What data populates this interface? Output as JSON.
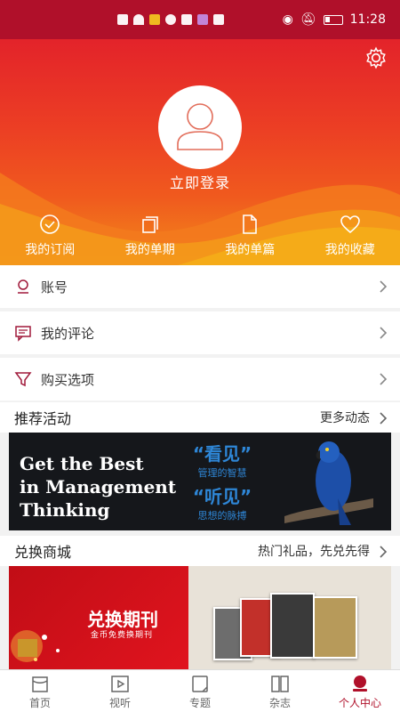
{
  "statusbar": {
    "time": "11:28"
  },
  "header": {
    "login_label": "立即登录",
    "quick_links": [
      {
        "label": "我的订阅",
        "icon": "check-circle-icon"
      },
      {
        "label": "我的单期",
        "icon": "copy-icon"
      },
      {
        "label": "我的单篇",
        "icon": "document-icon"
      },
      {
        "label": "我的收藏",
        "icon": "heart-icon"
      }
    ]
  },
  "menu": [
    {
      "label": "账号",
      "icon": "account-icon"
    },
    {
      "label": "我的评论",
      "icon": "comment-icon"
    },
    {
      "label": "购买选项",
      "icon": "filter-icon"
    }
  ],
  "recommend": {
    "title": "推荐活动",
    "more": "更多动态",
    "banner": {
      "en_lines": [
        "Get the Best",
        "in Management",
        "Thinking"
      ],
      "cn_big_1": "“看见”",
      "cn_small_1": "管理的智慧",
      "cn_big_2": "“听见”",
      "cn_small_2": "思想的脉搏"
    }
  },
  "exchange": {
    "title": "兑换商城",
    "more": "热门礼品，先兑先得",
    "banner": {
      "title": "兑换期刊",
      "subtitle": "金币免费换期刊"
    }
  },
  "nav": [
    {
      "label": "首页",
      "icon": "home-icon"
    },
    {
      "label": "视听",
      "icon": "video-icon"
    },
    {
      "label": "专题",
      "icon": "topic-icon"
    },
    {
      "label": "杂志",
      "icon": "magazine-icon"
    },
    {
      "label": "个人中心",
      "icon": "user-icon",
      "active": true
    }
  ],
  "colors": {
    "brand": "#b0102a",
    "header_top": "#e3232a",
    "header_bottom": "#f28a1a"
  }
}
